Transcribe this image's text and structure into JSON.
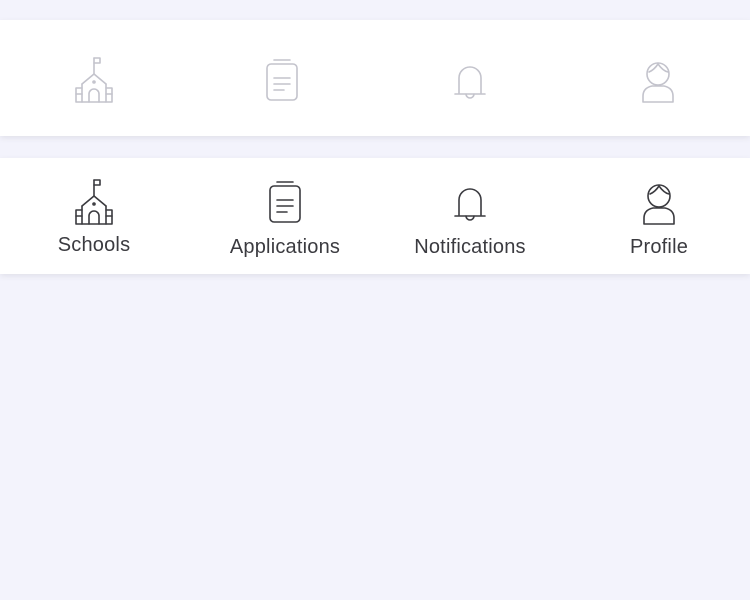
{
  "tab_bars": [
    {
      "state": "inactive",
      "items": [
        {
          "icon": "school-icon"
        },
        {
          "icon": "document-icon"
        },
        {
          "icon": "bell-icon"
        },
        {
          "icon": "user-icon"
        }
      ]
    },
    {
      "state": "active",
      "items": [
        {
          "icon": "school-icon",
          "label": "Schools"
        },
        {
          "icon": "document-icon",
          "label": "Applications"
        },
        {
          "icon": "bell-icon",
          "label": "Notifications"
        },
        {
          "icon": "user-icon",
          "label": "Profile"
        }
      ]
    }
  ],
  "colors": {
    "background": "#f3f3fc",
    "bar_background": "#ffffff",
    "inactive_icon": "#c3c3cc",
    "active_icon": "#3a3a3f",
    "label_text": "#3b3b40"
  }
}
